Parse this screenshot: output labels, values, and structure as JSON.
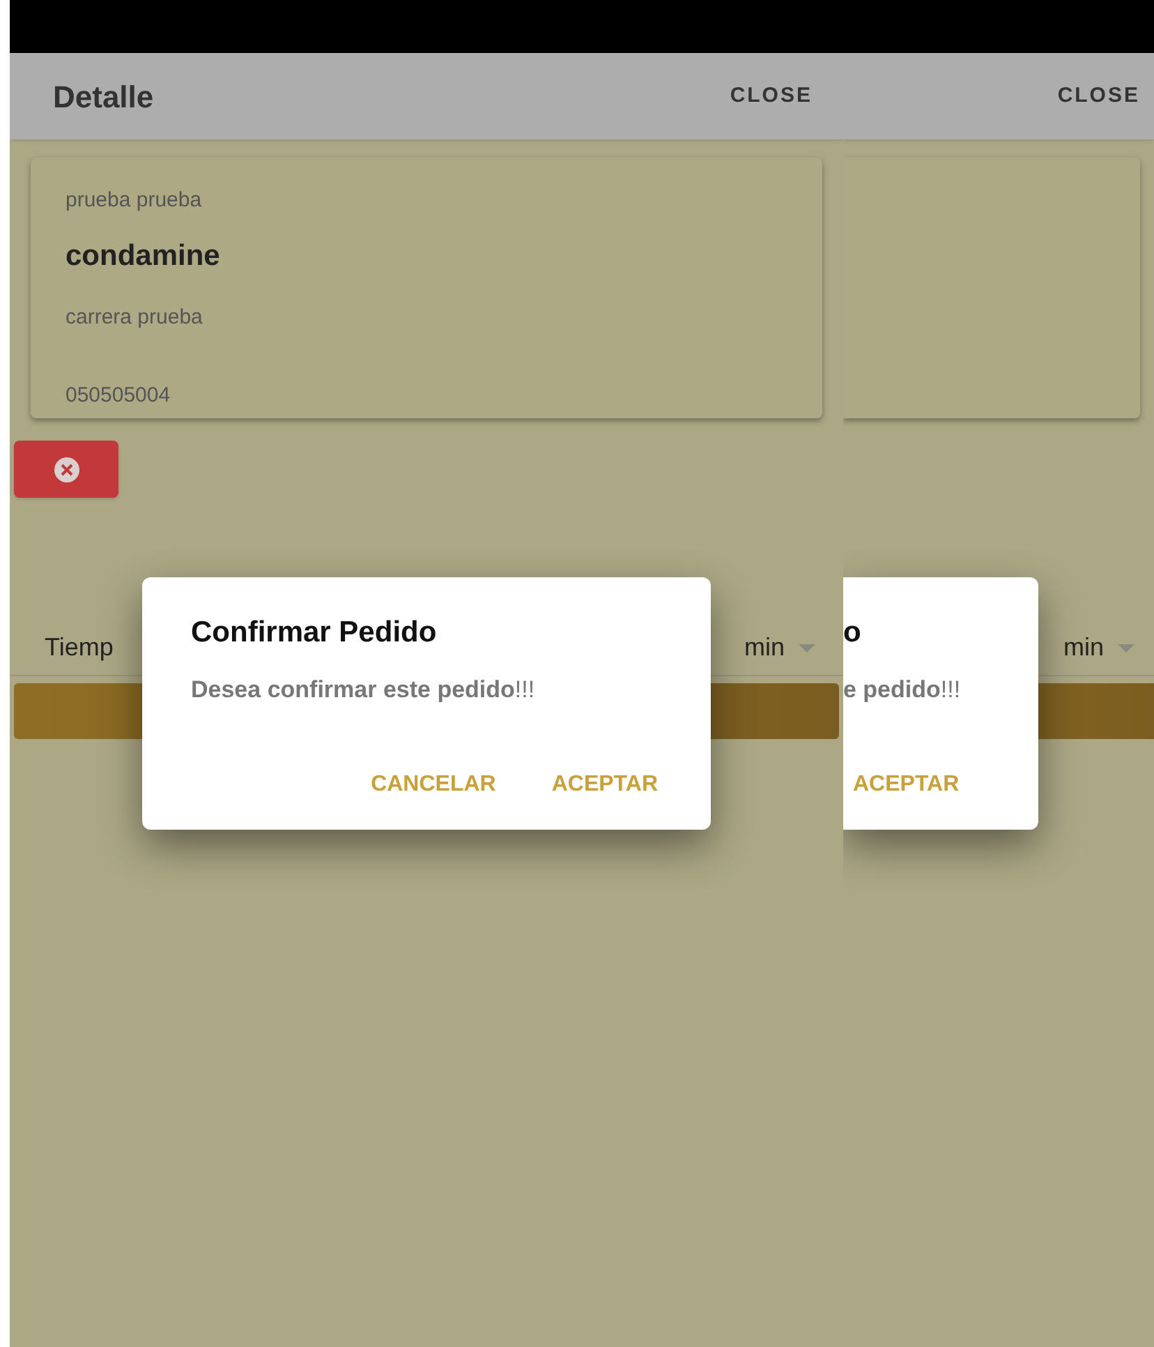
{
  "panes": [
    {
      "kind": "main",
      "header": {
        "title": "Detalle",
        "close_label": "CLOSE"
      },
      "card": {
        "subtitle": "prueba prueba",
        "name": "condamine",
        "address": "carrera prueba",
        "phone": "050505004"
      },
      "row": {
        "label": "Tiemp",
        "unit": "min"
      },
      "dialog": {
        "title": "Confirmar Pedido",
        "message": "**Desea confirmar este pedido**!!!",
        "buttons": [
          "CANCELAR",
          "ACEPTAR"
        ]
      }
    },
    {
      "kind": "fragment",
      "header": {
        "close_label": "CLOSE"
      },
      "row": {
        "unit": "min"
      },
      "dialog": {
        "title": "o",
        "message": "**e pedido**!!!",
        "buttons": [
          "ACEPTAR"
        ]
      }
    }
  ]
}
